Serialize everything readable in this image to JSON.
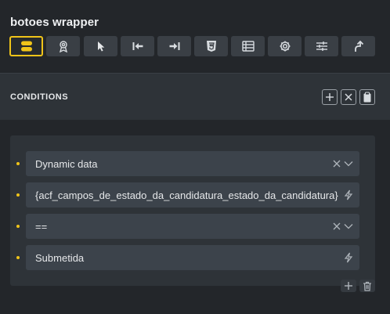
{
  "panel": {
    "title": "botoes wrapper"
  },
  "toolbar": {
    "buttons": [
      {
        "icon": "wrapper-icon",
        "active": true
      },
      {
        "icon": "badge-icon",
        "active": false
      },
      {
        "icon": "cursor-icon",
        "active": false
      },
      {
        "icon": "arrow-to-left-icon",
        "active": false
      },
      {
        "icon": "arrow-to-right-icon",
        "active": false
      },
      {
        "icon": "css-icon",
        "active": false
      },
      {
        "icon": "attributes-icon",
        "active": false
      },
      {
        "icon": "gear-icon",
        "active": false
      },
      {
        "icon": "sliders-icon",
        "active": false
      },
      {
        "icon": "arrow-up-curve-icon",
        "active": false
      }
    ]
  },
  "conditions": {
    "title": "CONDITIONS",
    "accent_color": "#f0c419",
    "items": [
      {
        "value": "Dynamic data",
        "icons": [
          "clear-icon",
          "chevron-down-icon"
        ]
      },
      {
        "value": "{acf_campos_de_estado_da_candidatura_estado_da_candidatura}",
        "icons": [
          "dynamic-data-icon"
        ]
      },
      {
        "value": "==",
        "icons": [
          "clear-icon",
          "chevron-down-icon"
        ]
      },
      {
        "value": "Submetida",
        "icons": [
          "dynamic-data-icon"
        ]
      }
    ]
  }
}
